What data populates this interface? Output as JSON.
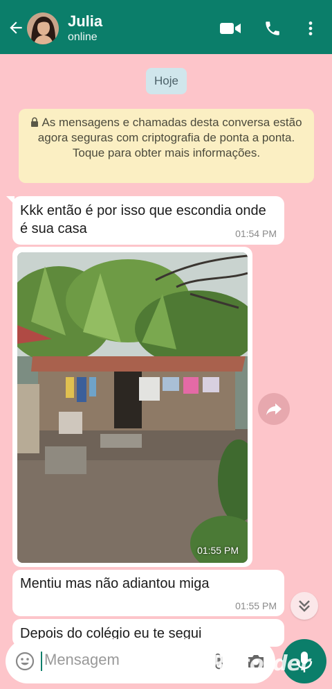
{
  "header": {
    "contact_name": "Julia",
    "contact_status": "online",
    "bg_color": "#0b7e6a",
    "icons": [
      "back-arrow-icon",
      "video-call-icon",
      "phone-icon",
      "more-vert-icon"
    ]
  },
  "date_chip": "Hoje",
  "encryption_notice": "As mensagens e chamadas desta conversa estão agora seguras com criptografia de ponta a ponta. Toque para obter mais informações.",
  "messages": [
    {
      "text": "Kkk então é por isso que escondia onde é sua casa",
      "time": "01:54 PM"
    },
    {
      "type": "image",
      "time": "01:55 PM"
    },
    {
      "text": "Mentiu mas não adiantou miga",
      "time": "01:55 PM"
    },
    {
      "text": "Depois do colégio eu te segui"
    }
  ],
  "composer": {
    "placeholder": "Mensagem",
    "watermark": "XRecorder"
  },
  "colors": {
    "chat_bg": "#fdc5ca",
    "bubble": "#ffffff",
    "notice_bg": "#fbefc3",
    "accent": "#0b7e6a"
  }
}
